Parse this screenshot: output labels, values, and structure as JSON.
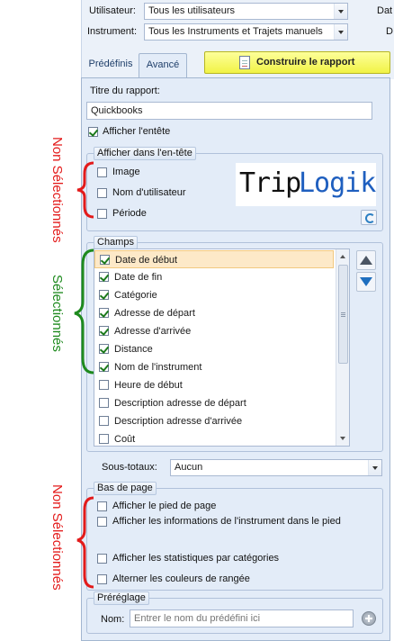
{
  "filters": {
    "user_label": "Utilisateur:",
    "user_value": "Tous les utilisateurs",
    "instrument_label": "Instrument:",
    "instrument_value": "Tous les Instruments et Trajets manuels",
    "right_cut_1": "Dat",
    "right_cut_2": "D"
  },
  "tabs": [
    {
      "label": "Prédéfinis",
      "active": false
    },
    {
      "label": "Avancé",
      "active": true
    }
  ],
  "build_button_label": "Construire le rapport",
  "report": {
    "title_label": "Titre du rapport:",
    "title_value": "Quickbooks",
    "show_header_label": "Afficher l'entête",
    "show_header_checked": true
  },
  "header_group": {
    "title": "Afficher dans l'en-tête",
    "items": [
      {
        "label": "Image",
        "checked": false
      },
      {
        "label": "Nom d'utilisateur",
        "checked": false
      },
      {
        "label": "Période",
        "checked": false
      }
    ],
    "logo_part1": "Trip",
    "logo_part2": "Logik",
    "logo_color1": "#111111",
    "logo_color2": "#1f5fbf"
  },
  "fields_group": {
    "title": "Champs",
    "items": [
      {
        "label": "Date de début",
        "checked": true,
        "selected": true
      },
      {
        "label": "Date de fin",
        "checked": true
      },
      {
        "label": "Catégorie",
        "checked": true
      },
      {
        "label": "Adresse de départ",
        "checked": true
      },
      {
        "label": "Adresse d'arrivée",
        "checked": true
      },
      {
        "label": "Distance",
        "checked": true
      },
      {
        "label": "Nom de l'instrument",
        "checked": true
      },
      {
        "label": "Heure de début",
        "checked": false
      },
      {
        "label": "Description adresse de départ",
        "checked": false
      },
      {
        "label": "Description adresse d'arrivée",
        "checked": false
      },
      {
        "label": "Coût",
        "checked": false
      }
    ]
  },
  "subtotals": {
    "label": "Sous-totaux:",
    "value": "Aucun"
  },
  "footer_group": {
    "title": "Bas de page",
    "items": [
      {
        "label": "Afficher le pied de page",
        "checked": false
      },
      {
        "label": "Afficher les informations de l'instrument dans le pied",
        "checked": false
      },
      {
        "label": "Afficher les statistiques par catégories",
        "checked": false
      },
      {
        "label": "Alterner les couleurs de rangée",
        "checked": false
      }
    ]
  },
  "preset_group": {
    "title": "Préréglage",
    "name_label": "Nom:",
    "name_placeholder": "Entrer le nom du prédéfini ici"
  },
  "annotations": {
    "not_selected_top": "Non Sélectionnés",
    "selected": "Sélectionnés",
    "not_selected_bottom": "Non Sélectionnés",
    "red": "#e31b1b",
    "green": "#1e8a1e"
  }
}
